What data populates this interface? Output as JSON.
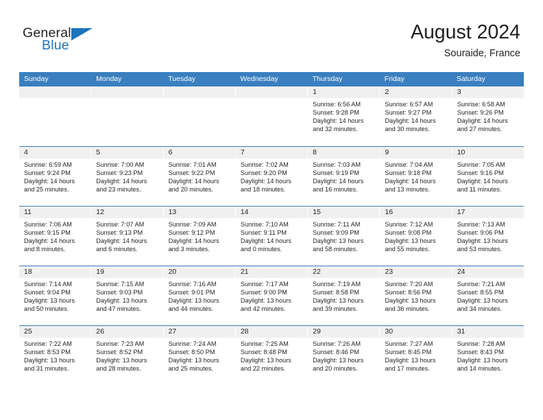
{
  "logo": {
    "word_one": "General",
    "word_two": "Blue",
    "triangle_icon": "triangle-icon",
    "accent_color": "#1b74bb"
  },
  "header": {
    "title": "August 2024",
    "subtitle": "Souraide, France"
  },
  "calendar": {
    "header_color": "#3a7fbf",
    "daynumber_band_color": "#f0f0f0",
    "weekdays": [
      "Sunday",
      "Monday",
      "Tuesday",
      "Wednesday",
      "Thursday",
      "Friday",
      "Saturday"
    ],
    "weeks": [
      [
        {
          "day": "",
          "empty": true,
          "sunrise": "",
          "sunset": "",
          "daylight_line1": "",
          "daylight_line2": ""
        },
        {
          "day": "",
          "empty": true,
          "sunrise": "",
          "sunset": "",
          "daylight_line1": "",
          "daylight_line2": ""
        },
        {
          "day": "",
          "empty": true,
          "sunrise": "",
          "sunset": "",
          "daylight_line1": "",
          "daylight_line2": ""
        },
        {
          "day": "",
          "empty": true,
          "sunrise": "",
          "sunset": "",
          "daylight_line1": "",
          "daylight_line2": ""
        },
        {
          "day": "1",
          "empty": false,
          "sunrise": "Sunrise: 6:56 AM",
          "sunset": "Sunset: 9:28 PM",
          "daylight_line1": "Daylight: 14 hours",
          "daylight_line2": "and 32 minutes."
        },
        {
          "day": "2",
          "empty": false,
          "sunrise": "Sunrise: 6:57 AM",
          "sunset": "Sunset: 9:27 PM",
          "daylight_line1": "Daylight: 14 hours",
          "daylight_line2": "and 30 minutes."
        },
        {
          "day": "3",
          "empty": false,
          "sunrise": "Sunrise: 6:58 AM",
          "sunset": "Sunset: 9:26 PM",
          "daylight_line1": "Daylight: 14 hours",
          "daylight_line2": "and 27 minutes."
        }
      ],
      [
        {
          "day": "4",
          "empty": false,
          "sunrise": "Sunrise: 6:59 AM",
          "sunset": "Sunset: 9:24 PM",
          "daylight_line1": "Daylight: 14 hours",
          "daylight_line2": "and 25 minutes."
        },
        {
          "day": "5",
          "empty": false,
          "sunrise": "Sunrise: 7:00 AM",
          "sunset": "Sunset: 9:23 PM",
          "daylight_line1": "Daylight: 14 hours",
          "daylight_line2": "and 23 minutes."
        },
        {
          "day": "6",
          "empty": false,
          "sunrise": "Sunrise: 7:01 AM",
          "sunset": "Sunset: 9:22 PM",
          "daylight_line1": "Daylight: 14 hours",
          "daylight_line2": "and 20 minutes."
        },
        {
          "day": "7",
          "empty": false,
          "sunrise": "Sunrise: 7:02 AM",
          "sunset": "Sunset: 9:20 PM",
          "daylight_line1": "Daylight: 14 hours",
          "daylight_line2": "and 18 minutes."
        },
        {
          "day": "8",
          "empty": false,
          "sunrise": "Sunrise: 7:03 AM",
          "sunset": "Sunset: 9:19 PM",
          "daylight_line1": "Daylight: 14 hours",
          "daylight_line2": "and 16 minutes."
        },
        {
          "day": "9",
          "empty": false,
          "sunrise": "Sunrise: 7:04 AM",
          "sunset": "Sunset: 9:18 PM",
          "daylight_line1": "Daylight: 14 hours",
          "daylight_line2": "and 13 minutes."
        },
        {
          "day": "10",
          "empty": false,
          "sunrise": "Sunrise: 7:05 AM",
          "sunset": "Sunset: 9:16 PM",
          "daylight_line1": "Daylight: 14 hours",
          "daylight_line2": "and 11 minutes."
        }
      ],
      [
        {
          "day": "11",
          "empty": false,
          "sunrise": "Sunrise: 7:06 AM",
          "sunset": "Sunset: 9:15 PM",
          "daylight_line1": "Daylight: 14 hours",
          "daylight_line2": "and 8 minutes."
        },
        {
          "day": "12",
          "empty": false,
          "sunrise": "Sunrise: 7:07 AM",
          "sunset": "Sunset: 9:13 PM",
          "daylight_line1": "Daylight: 14 hours",
          "daylight_line2": "and 6 minutes."
        },
        {
          "day": "13",
          "empty": false,
          "sunrise": "Sunrise: 7:09 AM",
          "sunset": "Sunset: 9:12 PM",
          "daylight_line1": "Daylight: 14 hours",
          "daylight_line2": "and 3 minutes."
        },
        {
          "day": "14",
          "empty": false,
          "sunrise": "Sunrise: 7:10 AM",
          "sunset": "Sunset: 9:11 PM",
          "daylight_line1": "Daylight: 14 hours",
          "daylight_line2": "and 0 minutes."
        },
        {
          "day": "15",
          "empty": false,
          "sunrise": "Sunrise: 7:11 AM",
          "sunset": "Sunset: 9:09 PM",
          "daylight_line1": "Daylight: 13 hours",
          "daylight_line2": "and 58 minutes."
        },
        {
          "day": "16",
          "empty": false,
          "sunrise": "Sunrise: 7:12 AM",
          "sunset": "Sunset: 9:08 PM",
          "daylight_line1": "Daylight: 13 hours",
          "daylight_line2": "and 55 minutes."
        },
        {
          "day": "17",
          "empty": false,
          "sunrise": "Sunrise: 7:13 AM",
          "sunset": "Sunset: 9:06 PM",
          "daylight_line1": "Daylight: 13 hours",
          "daylight_line2": "and 53 minutes."
        }
      ],
      [
        {
          "day": "18",
          "empty": false,
          "sunrise": "Sunrise: 7:14 AM",
          "sunset": "Sunset: 9:04 PM",
          "daylight_line1": "Daylight: 13 hours",
          "daylight_line2": "and 50 minutes."
        },
        {
          "day": "19",
          "empty": false,
          "sunrise": "Sunrise: 7:15 AM",
          "sunset": "Sunset: 9:03 PM",
          "daylight_line1": "Daylight: 13 hours",
          "daylight_line2": "and 47 minutes."
        },
        {
          "day": "20",
          "empty": false,
          "sunrise": "Sunrise: 7:16 AM",
          "sunset": "Sunset: 9:01 PM",
          "daylight_line1": "Daylight: 13 hours",
          "daylight_line2": "and 44 minutes."
        },
        {
          "day": "21",
          "empty": false,
          "sunrise": "Sunrise: 7:17 AM",
          "sunset": "Sunset: 9:00 PM",
          "daylight_line1": "Daylight: 13 hours",
          "daylight_line2": "and 42 minutes."
        },
        {
          "day": "22",
          "empty": false,
          "sunrise": "Sunrise: 7:19 AM",
          "sunset": "Sunset: 8:58 PM",
          "daylight_line1": "Daylight: 13 hours",
          "daylight_line2": "and 39 minutes."
        },
        {
          "day": "23",
          "empty": false,
          "sunrise": "Sunrise: 7:20 AM",
          "sunset": "Sunset: 8:56 PM",
          "daylight_line1": "Daylight: 13 hours",
          "daylight_line2": "and 36 minutes."
        },
        {
          "day": "24",
          "empty": false,
          "sunrise": "Sunrise: 7:21 AM",
          "sunset": "Sunset: 8:55 PM",
          "daylight_line1": "Daylight: 13 hours",
          "daylight_line2": "and 34 minutes."
        }
      ],
      [
        {
          "day": "25",
          "empty": false,
          "sunrise": "Sunrise: 7:22 AM",
          "sunset": "Sunset: 8:53 PM",
          "daylight_line1": "Daylight: 13 hours",
          "daylight_line2": "and 31 minutes."
        },
        {
          "day": "26",
          "empty": false,
          "sunrise": "Sunrise: 7:23 AM",
          "sunset": "Sunset: 8:52 PM",
          "daylight_line1": "Daylight: 13 hours",
          "daylight_line2": "and 28 minutes."
        },
        {
          "day": "27",
          "empty": false,
          "sunrise": "Sunrise: 7:24 AM",
          "sunset": "Sunset: 8:50 PM",
          "daylight_line1": "Daylight: 13 hours",
          "daylight_line2": "and 25 minutes."
        },
        {
          "day": "28",
          "empty": false,
          "sunrise": "Sunrise: 7:25 AM",
          "sunset": "Sunset: 8:48 PM",
          "daylight_line1": "Daylight: 13 hours",
          "daylight_line2": "and 22 minutes."
        },
        {
          "day": "29",
          "empty": false,
          "sunrise": "Sunrise: 7:26 AM",
          "sunset": "Sunset: 8:46 PM",
          "daylight_line1": "Daylight: 13 hours",
          "daylight_line2": "and 20 minutes."
        },
        {
          "day": "30",
          "empty": false,
          "sunrise": "Sunrise: 7:27 AM",
          "sunset": "Sunset: 8:45 PM",
          "daylight_line1": "Daylight: 13 hours",
          "daylight_line2": "and 17 minutes."
        },
        {
          "day": "31",
          "empty": false,
          "sunrise": "Sunrise: 7:28 AM",
          "sunset": "Sunset: 8:43 PM",
          "daylight_line1": "Daylight: 13 hours",
          "daylight_line2": "and 14 minutes."
        }
      ]
    ]
  }
}
